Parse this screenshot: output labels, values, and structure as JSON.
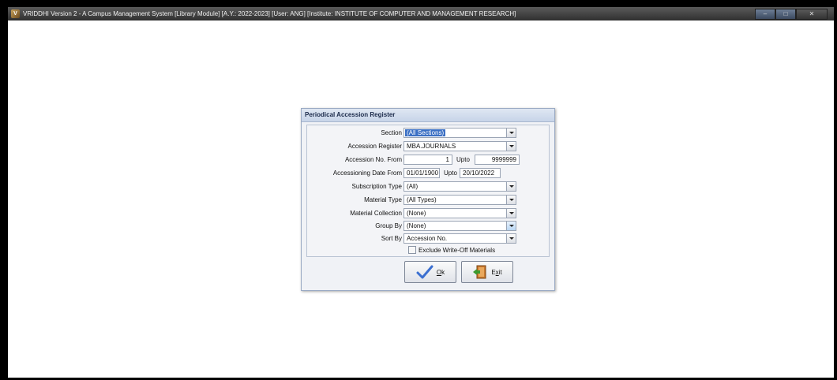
{
  "window": {
    "title": "VRIDDHI Version 2 - A Campus Management System [Library Module] [A.Y.: 2022-2023] [User: ANG] [Institute: INSTITUTE OF COMPUTER AND MANAGEMENT RESEARCH]",
    "app_icon": "vriddhi-app-icon",
    "controls": [
      "minimize",
      "maximize",
      "close"
    ]
  },
  "dialog": {
    "title": "Periodical Accession Register",
    "fields": {
      "section": {
        "label": "Section",
        "value": "(All Sections)"
      },
      "accession_register": {
        "label": "Accession Register",
        "value": "MBA.JOURNALS"
      },
      "accession_no": {
        "label": "Accession No. From",
        "from": "1",
        "upto_label": "Upto",
        "upto": "9999999"
      },
      "accession_date": {
        "label": "Accessioning Date From",
        "from": "01/01/1900",
        "upto_label": "Upto",
        "upto": "20/10/2022"
      },
      "subscription_type": {
        "label": "Subscription Type",
        "value": "(All)"
      },
      "material_type": {
        "label": "Material Type",
        "value": "(All Types)"
      },
      "material_collection": {
        "label": "Material Collection",
        "value": "(None)"
      },
      "group_by": {
        "label": "Group By",
        "value": "(None)"
      },
      "sort_by": {
        "label": "Sort By",
        "value": "Accession No."
      }
    },
    "exclude_checkbox": {
      "label": "Exclude Write-Off Materials",
      "checked": false
    },
    "buttons": {
      "ok": {
        "mnemonic": "O",
        "rest": "k"
      },
      "exit": {
        "before": "E",
        "mnemonic": "x",
        "rest": "it"
      }
    }
  }
}
